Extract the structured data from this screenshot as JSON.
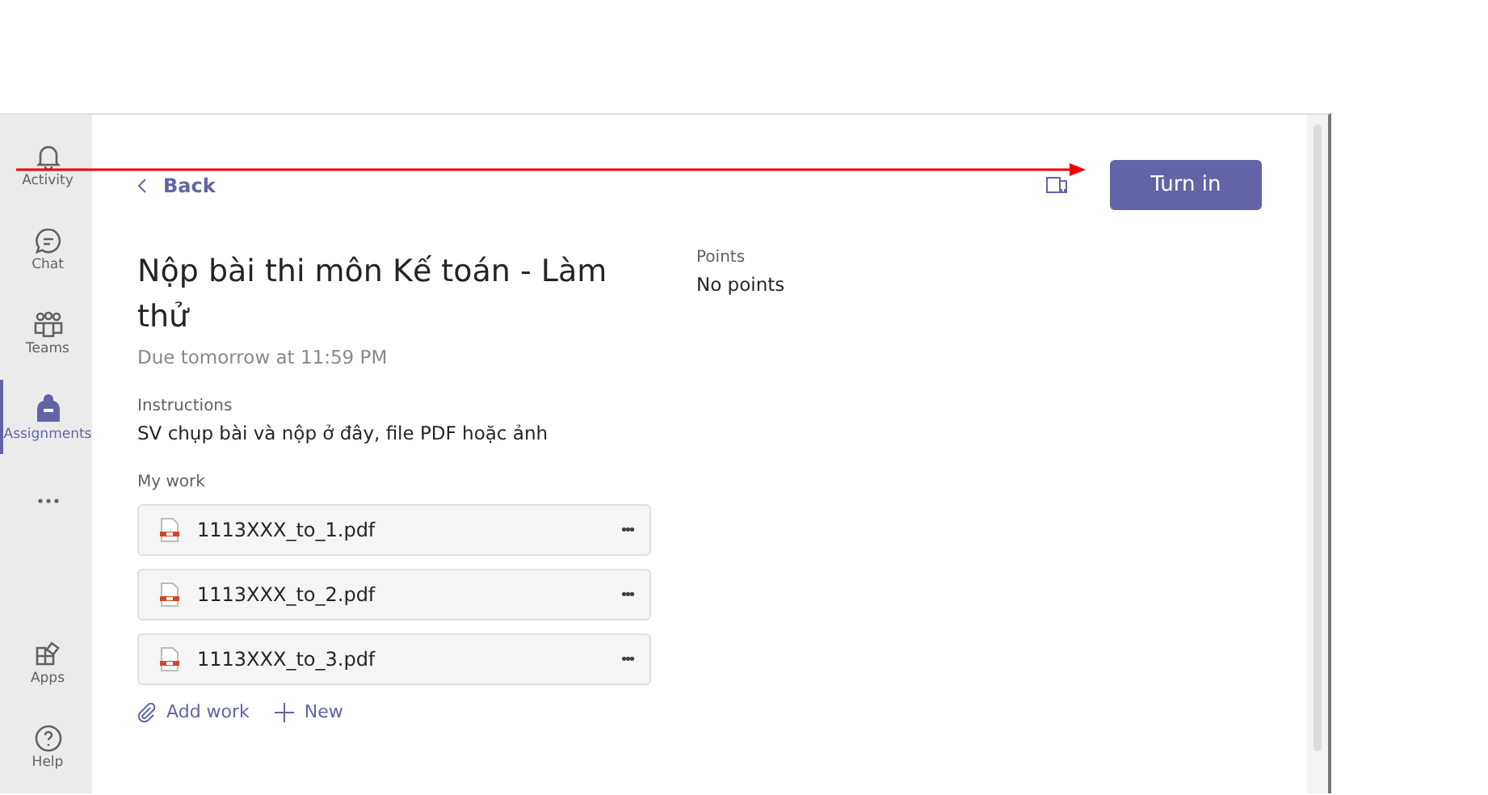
{
  "rail": [
    {
      "kind": "bell",
      "label": "Activity",
      "selected": false
    },
    {
      "kind": "chat",
      "label": "Chat",
      "selected": false
    },
    {
      "kind": "teams",
      "label": "Teams",
      "selected": false
    },
    {
      "kind": "bag",
      "label": "Assignments",
      "selected": true
    },
    {
      "kind": "more",
      "selected": false
    }
  ],
  "rail_bottom": [
    {
      "kind": "apps",
      "label": "Apps"
    },
    {
      "kind": "help",
      "label": "Help"
    }
  ],
  "back": "Back",
  "turn_in": "Turn in",
  "title": "Nộp bài thi môn Kế toán - Làm thử",
  "due": "Due tomorrow at 11:59 PM",
  "instructions": {
    "label": "Instructions",
    "text": "SV chụp bài và nộp ở đây, file PDF hoặc ảnh"
  },
  "points": {
    "label": "Points",
    "value": "No points"
  },
  "my_work": {
    "label": "My work",
    "files": [
      {
        "name": "1113XXX_to_1.pdf",
        "menu": "•••"
      },
      {
        "name": "1113XXX_to_2.pdf",
        "menu": "•••"
      },
      {
        "name": "1113XXX_to_3.pdf",
        "menu": "•••"
      }
    ]
  },
  "actions": [
    {
      "kind": "attach",
      "label": "Add work"
    },
    {
      "kind": "plus",
      "label": "New"
    }
  ]
}
